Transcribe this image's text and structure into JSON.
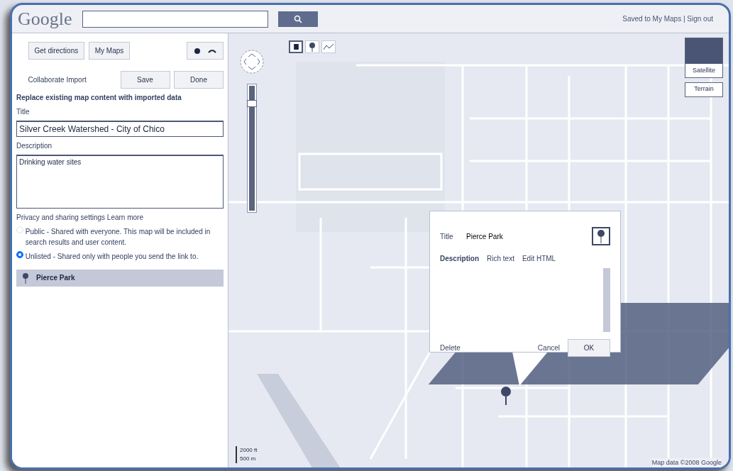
{
  "header": {
    "logo": "Google",
    "account_links": "Saved to My Maps | Sign out"
  },
  "sidebar": {
    "buttons": [
      "Get directions",
      "My Maps"
    ],
    "collab_label": "Collaborate  Import",
    "actions": [
      "Save",
      "Done"
    ],
    "notice": "Replace existing map content with imported data",
    "title_label": "Title",
    "title_value": "Silver Creek Watershed - City of Chico",
    "description_label": "Description",
    "description_value": "Drinking water sites",
    "privacy_label": "Privacy and sharing settings  Learn more",
    "privacy_options": [
      {
        "text": "Public - Shared with everyone. This map will be included in search results and user content.",
        "selected": false
      },
      {
        "text": "Unlisted - Shared only with people you send the link to.",
        "selected": true
      }
    ],
    "features": [
      {
        "name": "Pierce Park",
        "selected": true
      }
    ]
  },
  "map": {
    "tools": [
      {
        "kind": "hand",
        "selected": true
      },
      {
        "kind": "placemark",
        "selected": false
      },
      {
        "kind": "line",
        "selected": false
      }
    ],
    "zoom": {
      "level": 0.88
    },
    "map_types": [
      {
        "label": "Satellite",
        "kind": "thumb"
      },
      {
        "label": "Terrain",
        "kind": "plain"
      }
    ],
    "scale": [
      "2000 ft",
      "500 m"
    ],
    "copyright": "Map data ©2008 Google",
    "popup": {
      "title_label": "Title",
      "title_value": "Pierce Park",
      "tabs": [
        {
          "label": "Description",
          "selected": true
        },
        {
          "label": "Rich text",
          "selected": false
        },
        {
          "label": "Edit HTML",
          "selected": false
        }
      ],
      "delete": "Delete",
      "cancel": "Cancel",
      "ok": "OK"
    }
  }
}
